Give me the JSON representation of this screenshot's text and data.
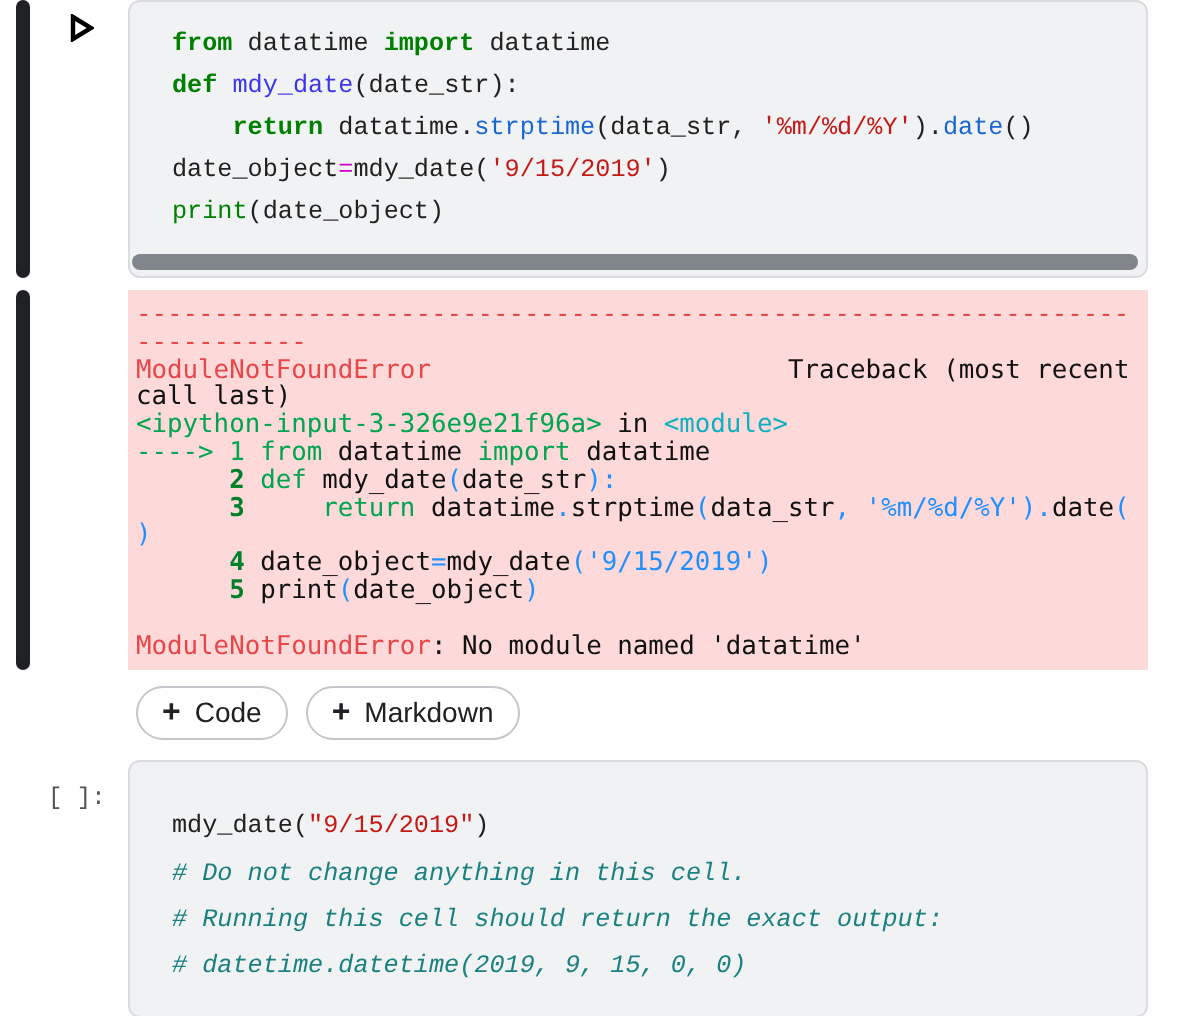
{
  "items": [
    {
      "kind": "code_cell",
      "selected": true,
      "scrollbar": true,
      "lines": [
        [
          {
            "text": "from",
            "kind": "kw"
          },
          {
            "text": " datatime ",
            "kind": "plain"
          },
          {
            "text": "import",
            "kind": "kw"
          },
          {
            "text": " datatime",
            "kind": "plain"
          }
        ],
        [
          {
            "text": "def",
            "kind": "kw"
          },
          {
            "text": " mdy_date",
            "kind": "fn"
          },
          {
            "text": "(date_str):",
            "kind": "plain"
          }
        ],
        [
          {
            "text": "    return",
            "kind": "kw"
          },
          {
            "text": " datatime.",
            "kind": "plain"
          },
          {
            "text": "strptime",
            "kind": "method"
          },
          {
            "text": "(data_str, ",
            "kind": "plain"
          },
          {
            "text": "'%m/%d/%Y'",
            "kind": "str"
          },
          {
            "text": ").",
            "kind": "plain"
          },
          {
            "text": "date",
            "kind": "method"
          },
          {
            "text": "()",
            "kind": "plain"
          }
        ],
        [
          {
            "text": "date_object",
            "kind": "plain"
          },
          {
            "text": "=",
            "kind": "op"
          },
          {
            "text": "mdy_date(",
            "kind": "plain"
          },
          {
            "text": "'9/15/2019'",
            "kind": "str"
          },
          {
            "text": ")",
            "kind": "plain"
          }
        ],
        [
          {
            "text": "print",
            "kind": "builtin"
          },
          {
            "text": "(date_object)",
            "kind": "plain"
          }
        ]
      ],
      "output": {
        "kind": "error",
        "lines": [
          [
            {
              "text": "----------------------------------------------------------------",
              "kind": "err"
            }
          ],
          [
            {
              "text": "-----------",
              "kind": "err"
            }
          ],
          [
            {
              "text": "ModuleNotFoundError",
              "kind": "err"
            },
            {
              "text": "                       Traceback (most recent",
              "kind": "plain"
            }
          ],
          [
            {
              "text": "call last)",
              "kind": "plain"
            }
          ],
          [
            {
              "text": "<ipython-input-3-326e9e21f96a>",
              "kind": "green"
            },
            {
              "text": " in ",
              "kind": "plain"
            },
            {
              "text": "<module>",
              "kind": "cyan"
            }
          ],
          [
            {
              "text": "----> 1 ",
              "kind": "green"
            },
            {
              "text": "from",
              "kind": "green"
            },
            {
              "text": " datatime ",
              "kind": "plain"
            },
            {
              "text": "import",
              "kind": "green"
            },
            {
              "text": " datatime",
              "kind": "plain"
            }
          ],
          [
            {
              "text": "      2",
              "kind": "lnum"
            },
            {
              "text": " def",
              "kind": "green"
            },
            {
              "text": " mdy_date",
              "kind": "plain"
            },
            {
              "text": "(",
              "kind": "blue"
            },
            {
              "text": "date_str",
              "kind": "plain"
            },
            {
              "text": "):",
              "kind": "blue"
            }
          ],
          [
            {
              "text": "      3",
              "kind": "lnum"
            },
            {
              "text": "     return",
              "kind": "green"
            },
            {
              "text": " datatime",
              "kind": "plain"
            },
            {
              "text": ".",
              "kind": "blue"
            },
            {
              "text": "strptime",
              "kind": "plain"
            },
            {
              "text": "(",
              "kind": "blue"
            },
            {
              "text": "data_str",
              "kind": "plain"
            },
            {
              "text": ", '%m/%d/%Y').",
              "kind": "blue"
            },
            {
              "text": "date",
              "kind": "plain"
            },
            {
              "text": "(",
              "kind": "blue"
            }
          ],
          [
            {
              "text": ")",
              "kind": "blue"
            }
          ],
          [
            {
              "text": "      4",
              "kind": "lnum"
            },
            {
              "text": " date_object",
              "kind": "plain"
            },
            {
              "text": "=",
              "kind": "blue"
            },
            {
              "text": "mdy_date",
              "kind": "plain"
            },
            {
              "text": "('9/15/2019')",
              "kind": "blue"
            }
          ],
          [
            {
              "text": "      5",
              "kind": "lnum"
            },
            {
              "text": " print",
              "kind": "plain"
            },
            {
              "text": "(",
              "kind": "blue"
            },
            {
              "text": "date_object",
              "kind": "plain"
            },
            {
              "text": ")",
              "kind": "blue"
            }
          ]
        ],
        "message": [
          {
            "text": "ModuleNotFoundError",
            "kind": "err"
          },
          {
            "text": ": No module named 'datatime'",
            "kind": "plain"
          }
        ]
      }
    },
    {
      "kind": "toolbar",
      "buttons": [
        {
          "icon": "+",
          "label": "Code"
        },
        {
          "icon": "+",
          "label": "Markdown"
        }
      ]
    },
    {
      "kind": "code_cell",
      "selected": false,
      "prompt": "[ ]:",
      "lines": [
        [
          {
            "text": "mdy_date(",
            "kind": "plain"
          },
          {
            "text": "\"9/15/2019\"",
            "kind": "str"
          },
          {
            "text": ")",
            "kind": "plain"
          }
        ],
        [
          {
            "text": "# Do not change anything in this cell.",
            "kind": "comment"
          }
        ],
        [
          {
            "text": "# Running this cell should return the exact output:",
            "kind": "comment"
          }
        ],
        [
          {
            "text": "# datetime.datetime(2019, 9, 15, 0, 0)",
            "kind": "comment"
          }
        ]
      ]
    }
  ]
}
